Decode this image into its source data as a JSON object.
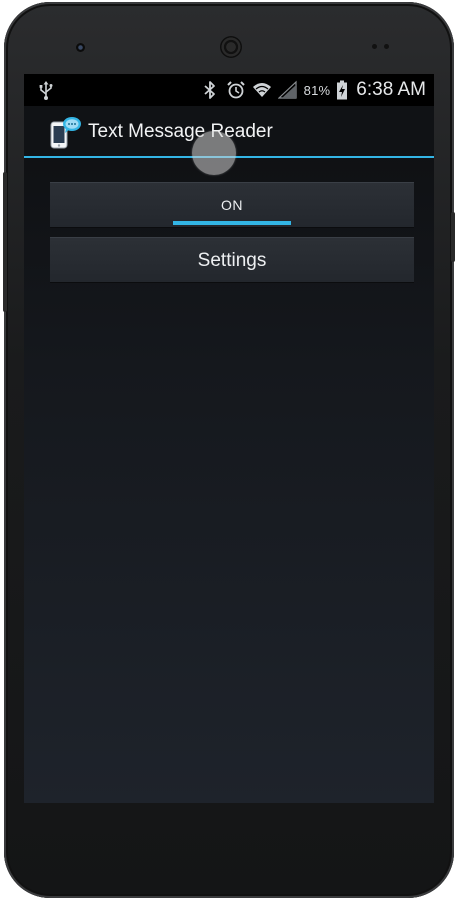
{
  "device": {
    "earpiece_icon": "speaker-grille-icon",
    "camera_icon": "front-camera-icon"
  },
  "status_bar": {
    "left_icons": [
      "usb-icon"
    ],
    "right_icons": [
      "bluetooth-icon",
      "alarm-icon",
      "wifi-icon",
      "signal-icon",
      "battery-charging-icon"
    ],
    "battery_percent": "81%",
    "time": "6:38 AM"
  },
  "action_bar": {
    "app_icon": "text-message-reader-app-icon",
    "title": "Text Message Reader",
    "accent_color": "#33b5e5"
  },
  "main": {
    "toggle_button": {
      "label": "ON",
      "state": "on"
    },
    "settings_button": {
      "label": "Settings"
    }
  },
  "colors": {
    "accent": "#33b5e5",
    "button_bg": "#2a2e34",
    "screen_bg_top": "#0d0e10",
    "screen_bg_bottom": "#1e232b"
  }
}
